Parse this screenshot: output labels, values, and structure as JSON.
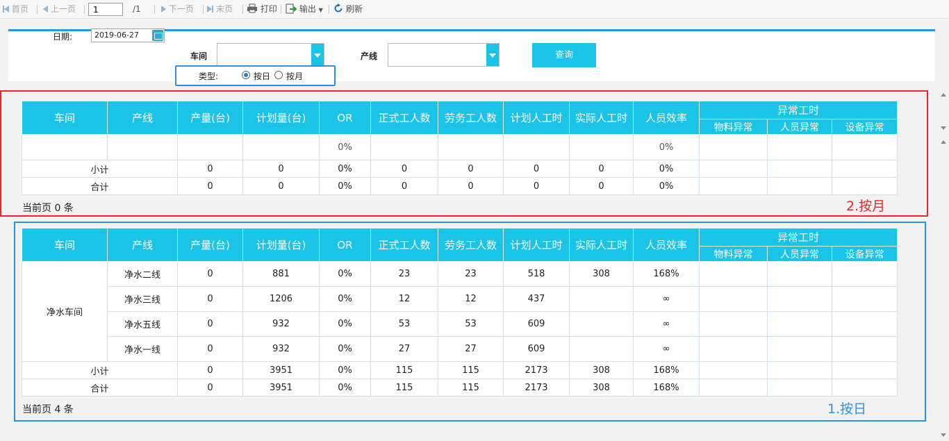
{
  "toolbar": {
    "first": "首页",
    "prev": "上一页",
    "page_value": "1",
    "page_total": "/1",
    "next": "下一页",
    "last": "末页",
    "print": "打印",
    "export": "输出",
    "refresh": "刷新"
  },
  "query": {
    "date_label": "日期:",
    "date_value": "2019-06-27",
    "workshop_label": "车间",
    "workshop_value": "",
    "line_label": "产线",
    "line_value": "",
    "query_button": "查询",
    "type_label": "类型:",
    "type_options": [
      "按日",
      "按月"
    ],
    "type_selected": "按日"
  },
  "columns": [
    "车间",
    "产线",
    "产量(台)",
    "计划量(台)",
    "OR",
    "正式工人数",
    "劳务工人数",
    "计划人工时",
    "实际人工时",
    "人员效率"
  ],
  "abnormal_group": "异常工时",
  "abnormal_columns": [
    "物料异常",
    "人员异常",
    "设备异常"
  ],
  "month_table": {
    "rows": [
      {
        "workshop": "",
        "line": "",
        "output": "",
        "plan": "",
        "or": "0%",
        "regular": "",
        "labor": "",
        "plan_hours": "",
        "actual_hours": "",
        "efficiency": "0%"
      }
    ],
    "subtotal": {
      "label": "小计",
      "output": "0",
      "plan": "0",
      "or": "0%",
      "regular": "0",
      "labor": "0",
      "plan_hours": "0",
      "actual_hours": "0",
      "efficiency": "0%"
    },
    "total": {
      "label": "合计",
      "output": "0",
      "plan": "0",
      "or": "0%",
      "regular": "0",
      "labor": "0",
      "plan_hours": "0",
      "actual_hours": "0",
      "efficiency": "0%"
    },
    "page_info": "当前页 0 条",
    "annotation": "2.按月",
    "annotation_color": "#e8262b"
  },
  "day_table": {
    "workshop": "净水车间",
    "rows": [
      {
        "line": "净水二线",
        "output": "0",
        "plan": "881",
        "or": "0%",
        "regular": "23",
        "labor": "23",
        "plan_hours": "518",
        "actual_hours": "308",
        "efficiency": "168%"
      },
      {
        "line": "净水三线",
        "output": "0",
        "plan": "1206",
        "or": "0%",
        "regular": "12",
        "labor": "12",
        "plan_hours": "437",
        "actual_hours": "",
        "efficiency": "∞"
      },
      {
        "line": "净水五线",
        "output": "0",
        "plan": "932",
        "or": "0%",
        "regular": "53",
        "labor": "53",
        "plan_hours": "609",
        "actual_hours": "",
        "efficiency": "∞"
      },
      {
        "line": "净水一线",
        "output": "0",
        "plan": "932",
        "or": "0%",
        "regular": "27",
        "labor": "27",
        "plan_hours": "609",
        "actual_hours": "",
        "efficiency": "∞"
      }
    ],
    "subtotal": {
      "label": "小计",
      "output": "0",
      "plan": "3951",
      "or": "0%",
      "regular": "115",
      "labor": "115",
      "plan_hours": "2173",
      "actual_hours": "308",
      "efficiency": "168%"
    },
    "total": {
      "label": "合计",
      "output": "0",
      "plan": "3951",
      "or": "0%",
      "regular": "115",
      "labor": "115",
      "plan_hours": "2173",
      "actual_hours": "308",
      "efficiency": "168%"
    },
    "page_info": "当前页 4 条",
    "annotation": "1.按日",
    "annotation_color": "#2d8fe6"
  },
  "colors": {
    "header": "#19c4e6",
    "accent": "#1e9fd9"
  }
}
